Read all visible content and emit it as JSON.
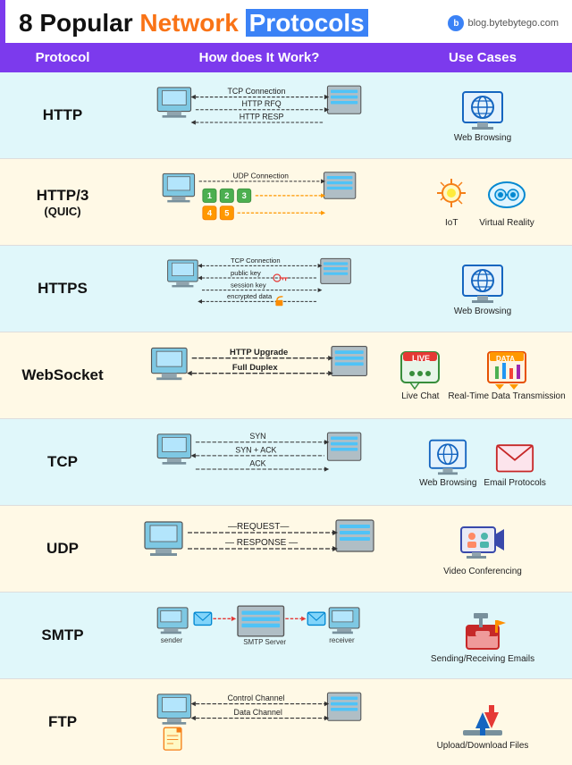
{
  "header": {
    "title_prefix": "8 Popular ",
    "title_network": "Network",
    "title_protocols": "Protocols",
    "brand": "blog.bytebytego.com"
  },
  "table_header": {
    "col1": "Protocol",
    "col2": "How does It Work?",
    "col3": "Use Cases"
  },
  "rows": [
    {
      "id": "http",
      "label": "HTTP",
      "sub": "",
      "bg": "light-blue",
      "diagram_lines": [
        "TCP Connection",
        "HTTP RFQ",
        "HTTP RESP"
      ],
      "diagram_arrows": [
        "right",
        "right",
        "left"
      ],
      "usecases": [
        {
          "label": "Web Browsing",
          "icon": "globe"
        }
      ]
    },
    {
      "id": "http3",
      "label": "HTTP/3",
      "sub": "(QUIC)",
      "bg": "light-yellow",
      "diagram_lines": [
        "UDP Connection",
        "1 2 3",
        "4 5"
      ],
      "usecases": [
        {
          "label": "IoT",
          "icon": "iot"
        },
        {
          "label": "Virtual Reality",
          "icon": "vr"
        }
      ]
    },
    {
      "id": "https",
      "label": "HTTPS",
      "sub": "",
      "bg": "light-blue",
      "diagram_lines": [
        "TCP Connection",
        "public key",
        "session key",
        "encrypted data"
      ],
      "usecases": [
        {
          "label": "Web Browsing",
          "icon": "globe"
        }
      ]
    },
    {
      "id": "websocket",
      "label": "WebSocket",
      "sub": "",
      "bg": "light-yellow",
      "diagram_lines": [
        "HTTP Upgrade",
        "Full Duplex"
      ],
      "usecases": [
        {
          "label": "Live Chat",
          "icon": "chat"
        },
        {
          "label": "Real-Time Data Transmission",
          "icon": "realtime"
        }
      ]
    },
    {
      "id": "tcp",
      "label": "TCP",
      "sub": "",
      "bg": "light-blue",
      "diagram_lines": [
        "SYN",
        "SYN + ACK",
        "ACK"
      ],
      "usecases": [
        {
          "label": "Web Browsing",
          "icon": "globe"
        },
        {
          "label": "Email Protocols",
          "icon": "email"
        }
      ]
    },
    {
      "id": "udp",
      "label": "UDP",
      "sub": "",
      "bg": "light-yellow",
      "diagram_lines": [
        "REQUEST",
        "RESPONSE"
      ],
      "usecases": [
        {
          "label": "Video Conferencing",
          "icon": "video"
        }
      ]
    },
    {
      "id": "smtp",
      "label": "SMTP",
      "sub": "",
      "bg": "light-blue",
      "diagram_lines": [
        "sender",
        "SMTP Server",
        "receiver"
      ],
      "usecases": [
        {
          "label": "Sending/Receiving Emails",
          "icon": "mailbox"
        }
      ]
    },
    {
      "id": "ftp",
      "label": "FTP",
      "sub": "",
      "bg": "light-yellow",
      "diagram_lines": [
        "Control Channel",
        "Data Channel"
      ],
      "usecases": [
        {
          "label": "Upload/Download Files",
          "icon": "files"
        }
      ]
    }
  ]
}
